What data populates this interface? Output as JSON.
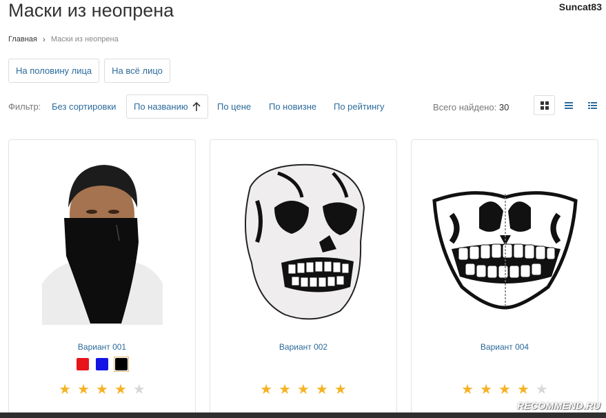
{
  "page": {
    "title": "Маски из неопрена",
    "username": "Suncat83"
  },
  "breadcrumb": {
    "home": "Главная",
    "separator": "›",
    "current": "Маски из неопрена"
  },
  "subcategories": [
    "На половину лица",
    "На всё лицо"
  ],
  "filter": {
    "label": "Фильтр:",
    "sorts": [
      "Без сортировки",
      "По названию",
      "По цене",
      "По новизне",
      "По рейтингу"
    ],
    "active_sort": "По названию",
    "total_label": "Всего найдено:",
    "total_count": "30",
    "views": [
      {
        "icon": "grid-view-icon",
        "active": true
      },
      {
        "icon": "list-view-icon",
        "active": false
      },
      {
        "icon": "detailed-list-view-icon",
        "active": false
      }
    ]
  },
  "products": [
    {
      "name": "Вариант 001",
      "image": "man-black-neoprene-half-mask",
      "rating": 4,
      "max_rating": 5,
      "swatches": [
        {
          "color": "#e8141b",
          "selected": false
        },
        {
          "color": "#1313e5",
          "selected": false
        },
        {
          "color": "#000000",
          "selected": true
        }
      ]
    },
    {
      "name": "Вариант 002",
      "image": "skull-full-face-mask",
      "rating": 5,
      "max_rating": 5,
      "swatches": []
    },
    {
      "name": "Вариант 004",
      "image": "skull-half-face-mask",
      "rating": 4,
      "max_rating": 5,
      "swatches": []
    }
  ],
  "colors": {
    "link": "#2b6a9b",
    "star": "#f5b324",
    "star_off": "#d8d8d8",
    "border": "#dcdcdc"
  },
  "badge": "RECOMMEND.RU"
}
